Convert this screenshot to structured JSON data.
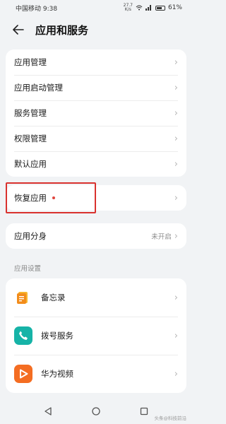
{
  "status_bar": {
    "carrier_time": "中国移动 9:38",
    "net_speed_value": "27.7",
    "net_speed_unit": "K/s",
    "battery": "61%"
  },
  "header": {
    "title": "应用和服务"
  },
  "card1": {
    "items": [
      {
        "label": "应用管理"
      },
      {
        "label": "应用启动管理"
      },
      {
        "label": "服务管理"
      },
      {
        "label": "权限管理"
      },
      {
        "label": "默认应用"
      }
    ]
  },
  "card2": {
    "label": "恢复应用"
  },
  "card3": {
    "label": "应用分身",
    "value": "未开启"
  },
  "section": {
    "label": "应用设置"
  },
  "apps": [
    {
      "label": "备忘录",
      "icon": "memo-icon",
      "color": "#f59e1b"
    },
    {
      "label": "拨号服务",
      "icon": "phone-icon",
      "color": "#16b3a7"
    },
    {
      "label": "华为视频",
      "icon": "video-play-icon",
      "color": "#f46d22"
    }
  ],
  "colors": {
    "accent_red": "#d9322e",
    "badge_dot": "#e0463e"
  },
  "watermark": "头条@科技前沿"
}
